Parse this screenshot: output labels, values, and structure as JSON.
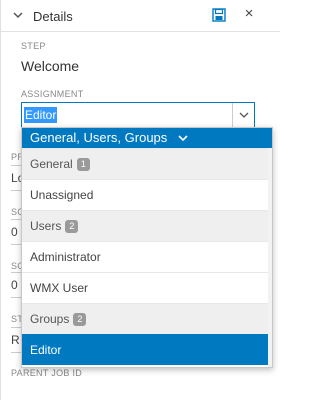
{
  "header": {
    "title": "Details",
    "close_label": "×"
  },
  "step": {
    "label": "STEP",
    "value": "Welcome"
  },
  "assignment": {
    "label": "ASSIGNMENT",
    "value": "Editor"
  },
  "background": {
    "label_pr": "PR",
    "field1_text": "Lo",
    "label_sc1": "SC",
    "field2_text": "0",
    "label_sc2": "SC",
    "field3_text": "0",
    "label_st": "STA",
    "field4_text": "R",
    "label_parent": "PARENT JOB ID"
  },
  "dropdown": {
    "filter_text": "General, Users, Groups",
    "items": [
      {
        "label": "General",
        "badge": "1",
        "type": "group"
      },
      {
        "label": "Unassigned",
        "badge": "",
        "type": "item"
      },
      {
        "label": "Users",
        "badge": "2",
        "type": "group"
      },
      {
        "label": "Administrator",
        "badge": "",
        "type": "item"
      },
      {
        "label": "WMX User",
        "badge": "",
        "type": "item"
      },
      {
        "label": "Groups",
        "badge": "2",
        "type": "group"
      },
      {
        "label": "Editor",
        "badge": "",
        "type": "selected"
      }
    ]
  },
  "colors": {
    "accent": "#0079c1",
    "selection": "#3399ff",
    "group_bg": "#efefef"
  }
}
